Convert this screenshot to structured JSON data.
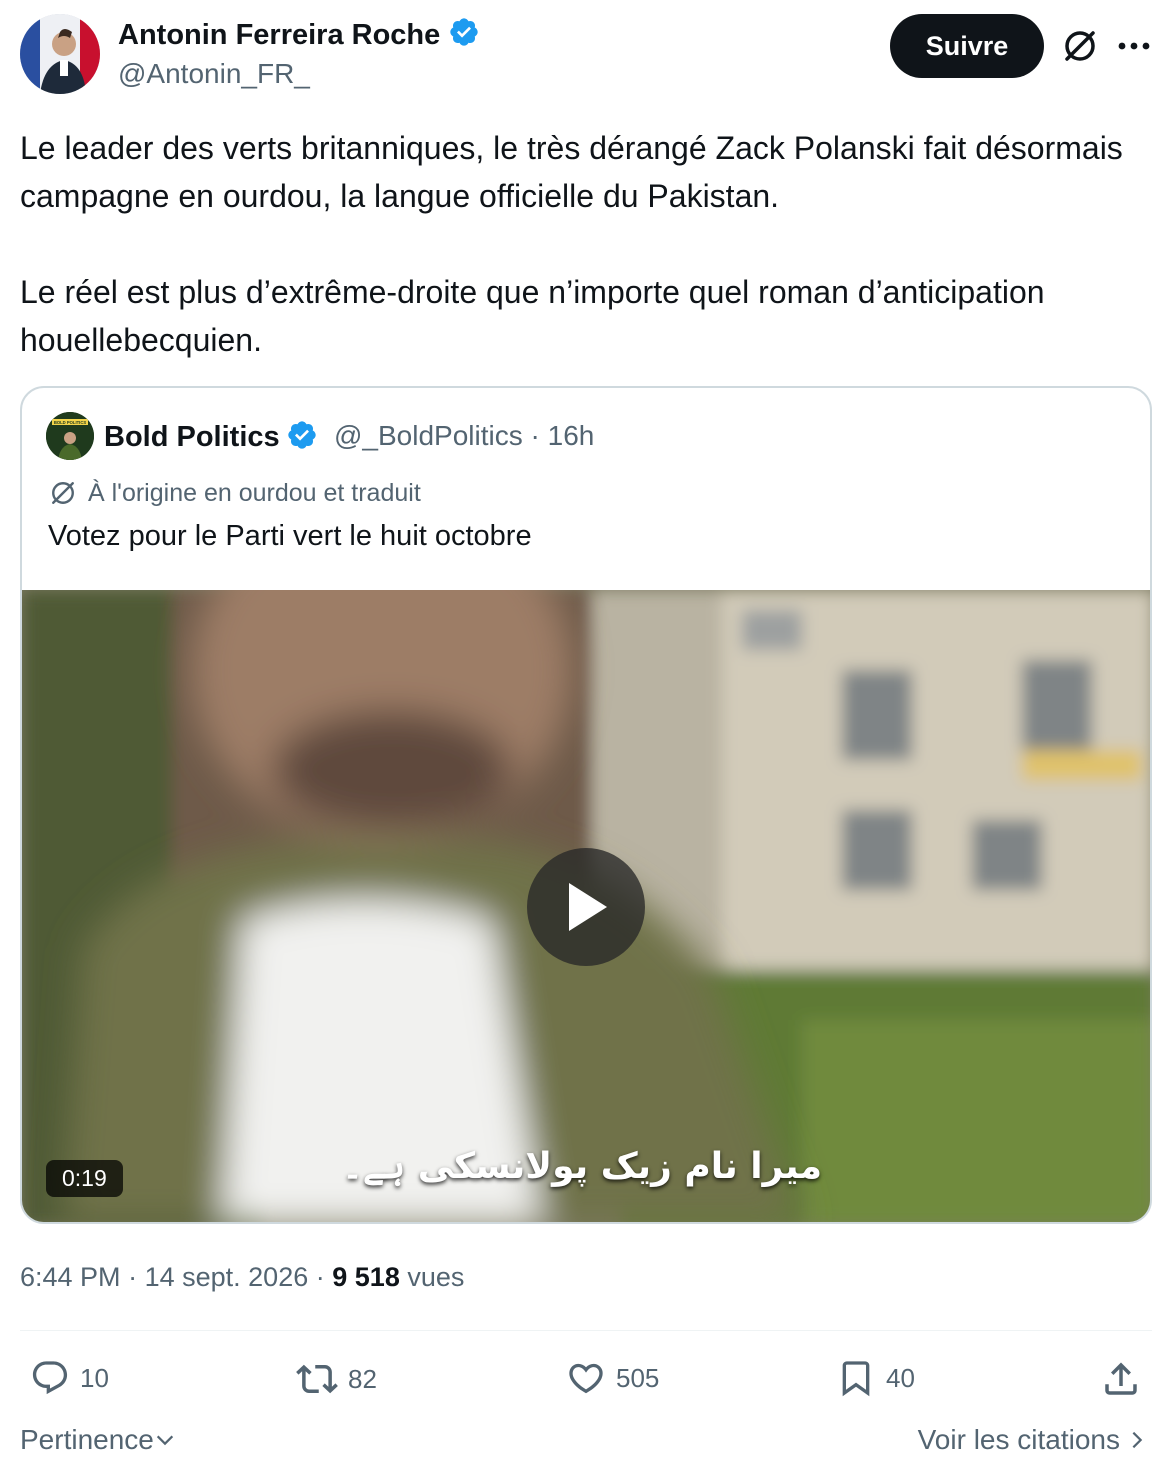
{
  "author": {
    "name": "Antonin Ferreira Roche",
    "handle": "@Antonin_FR_",
    "verified": true
  },
  "header_actions": {
    "follow_label": "Suivre",
    "translate_icon": "no-translate-icon",
    "more_icon": "more-icon"
  },
  "tweet": {
    "line1": "Le leader des verts britanniques, le très dérangé Zack Polanski fait désormais campagne en ourdou, la langue officielle du Pakistan.",
    "line2": "Le réel est plus d’extrême-droite que n’importe quel roman d’anticipation houellebecquien."
  },
  "quoted": {
    "name": "Bold Politics",
    "handle": "@_BoldPolitics",
    "separator": "·",
    "time": "16h",
    "translated_note": "À l'origine en ourdou et traduit",
    "text": "Votez pour le Parti vert le huit octobre",
    "avatar_text": "BOLD POLITICS",
    "video": {
      "duration": "0:19",
      "subtitle": "میرا نام زیک پولانسکی ہے۔"
    }
  },
  "meta": {
    "time": "6:44 PM",
    "date": "14 sept. 2026",
    "separator": "·",
    "views_count": "9 518",
    "views_label": "vues"
  },
  "actions": {
    "replies": "10",
    "reposts": "82",
    "likes": "505",
    "bookmarks": "40"
  },
  "footer": {
    "sort_label": "Pertinence",
    "quotes_label": "Voir les citations"
  },
  "colors": {
    "text": "#0f1419",
    "secondary": "#536471",
    "verified": "#1d9bf0",
    "border": "#cfd9de"
  }
}
